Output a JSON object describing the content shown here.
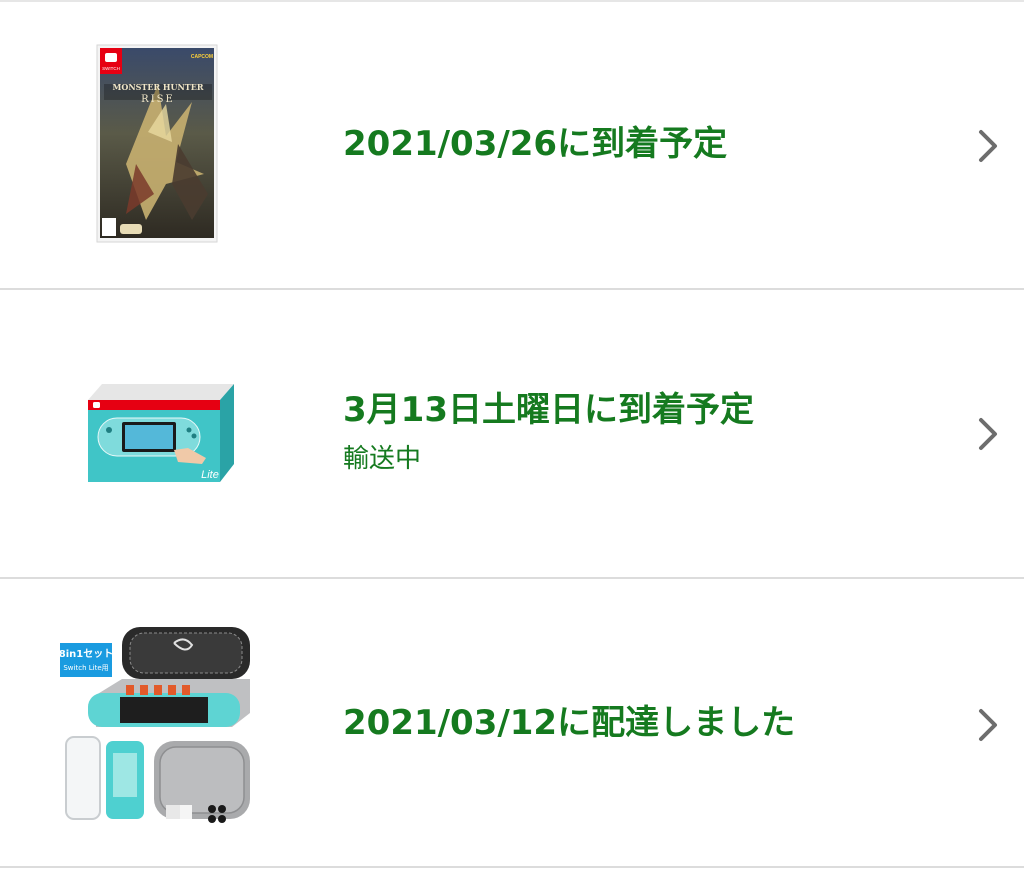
{
  "orders": [
    {
      "status": "2021/03/26に到着予定",
      "substatus": "",
      "product_image": {
        "name": "monster-hunter-rise-box",
        "box_text": [
          "MONSTER HUNTER",
          "RISE"
        ],
        "platform_badge": "SWITCH",
        "publisher": "CAPCOM"
      }
    },
    {
      "status": "3月13日土曜日に到着予定",
      "substatus": "輸送中",
      "product_image": {
        "name": "switch-lite-turquoise-box",
        "box_text": "Lite"
      }
    },
    {
      "status": "2021/03/12に配達しました",
      "substatus": "",
      "product_image": {
        "name": "switch-lite-case-set",
        "badge_line1": "8in1セット",
        "badge_line2": "Switch Lite用"
      }
    }
  ],
  "colors": {
    "status_green": "#157a1f",
    "divider": "#dcdcdc",
    "chevron": "#6d6d6d",
    "switch_turquoise": "#3cc4c6",
    "switch_red": "#e60012"
  },
  "icons": {
    "row_action": "chevron-right-icon"
  }
}
